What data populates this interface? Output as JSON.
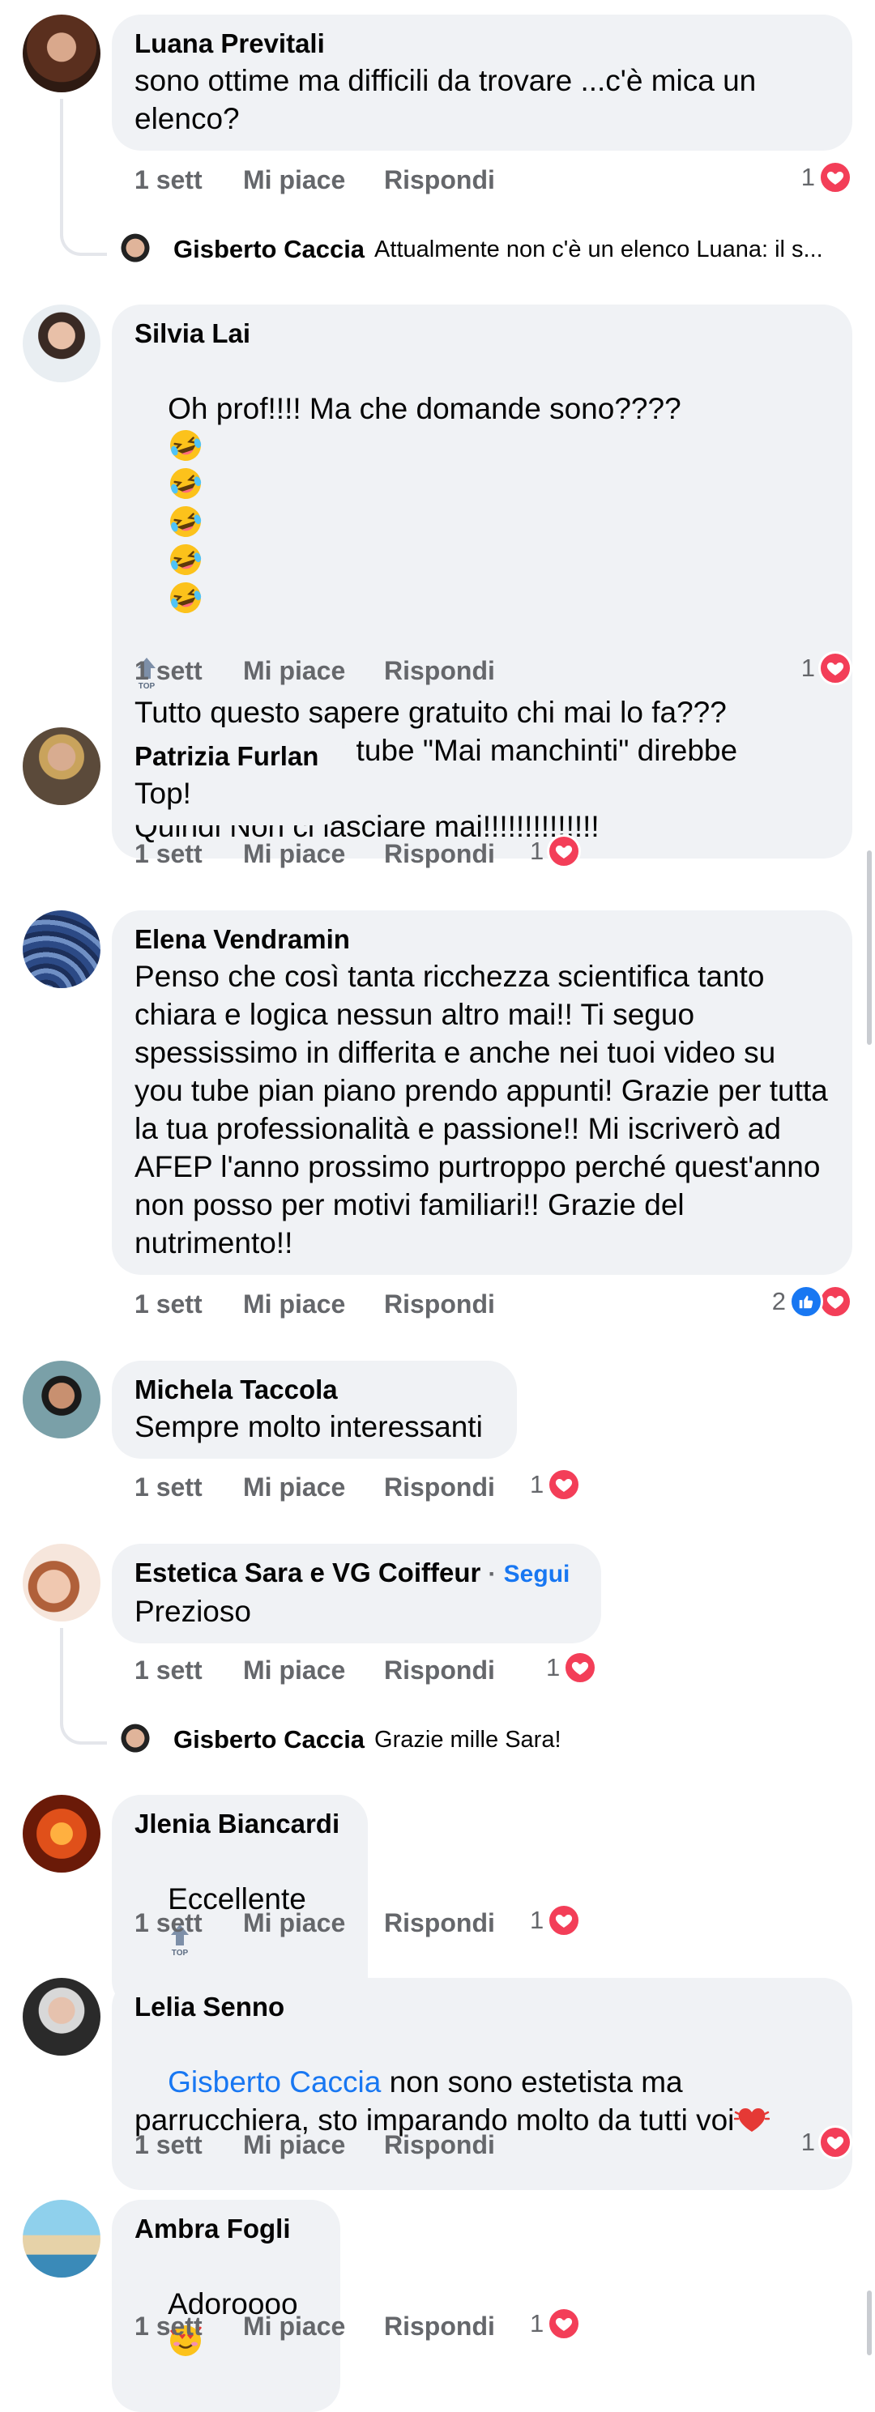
{
  "ui": {
    "time": "1 sett",
    "like": "Mi piace",
    "reply": "Rispondi",
    "follow": "Segui",
    "follow_dot": "·"
  },
  "colors": {
    "bubble": "#f0f2f5",
    "secondary_text": "#65676b",
    "link": "#1877f2",
    "love": "#f33e58",
    "like": "#1877f2"
  },
  "comments": [
    {
      "name": "Luana Previtali",
      "text": "sono ottime ma difficili da trovare ...c'è mica un elenco?",
      "reactions": "1",
      "reply": {
        "name": "Gisberto Caccia",
        "text": "Attualmente non c'è un elenco Luana: il s..."
      }
    },
    {
      "name": "Silvia Lai",
      "text_line1": "Oh prof!!!! Ma che domande sono????",
      "text_line3": "Tutto questo sapere gratuito chi mai lo fa???\nFacebook e you tube \"Mai manchinti\" direbbe nonna....\nQuindi Non ci lasciare mai!!!!!!!!!!!!!!",
      "reactions": "1"
    },
    {
      "name": "Patrizia Furlan",
      "text": "Top!",
      "reactions": "1"
    },
    {
      "name": "Elena Vendramin",
      "text": "Penso che così tanta ricchezza scientifica tanto chiara e logica nessun altro mai!! Ti seguo spessissimo in differita e anche nei tuoi video su you tube pian piano prendo appunti! Grazie per tutta la tua professionalità e passione!! Mi iscriverò ad AFEP l'anno prossimo purtroppo perché quest'anno non posso per motivi familiari!! Grazie del nutrimento!!",
      "reactions": "2"
    },
    {
      "name": "Michela Taccola",
      "text": "Sempre molto interessanti",
      "reactions": "1"
    },
    {
      "name": "Estetica Sara e VG Coiffeur",
      "text": "Prezioso",
      "reactions": "1",
      "reply": {
        "name": "Gisberto Caccia",
        "text": "Grazie mille Sara!"
      }
    },
    {
      "name": "Jlenia Biancardi",
      "text": "Eccellente",
      "reactions": "1"
    },
    {
      "name": "Lelia Senno",
      "mention": "Gisberto Caccia",
      "text": " non sono estetista ma parrucchiera, sto imparando molto da tutti voi",
      "reactions": "1"
    },
    {
      "name": "Ambra Fogli",
      "text": "Adoroooo",
      "reactions": "1"
    }
  ]
}
